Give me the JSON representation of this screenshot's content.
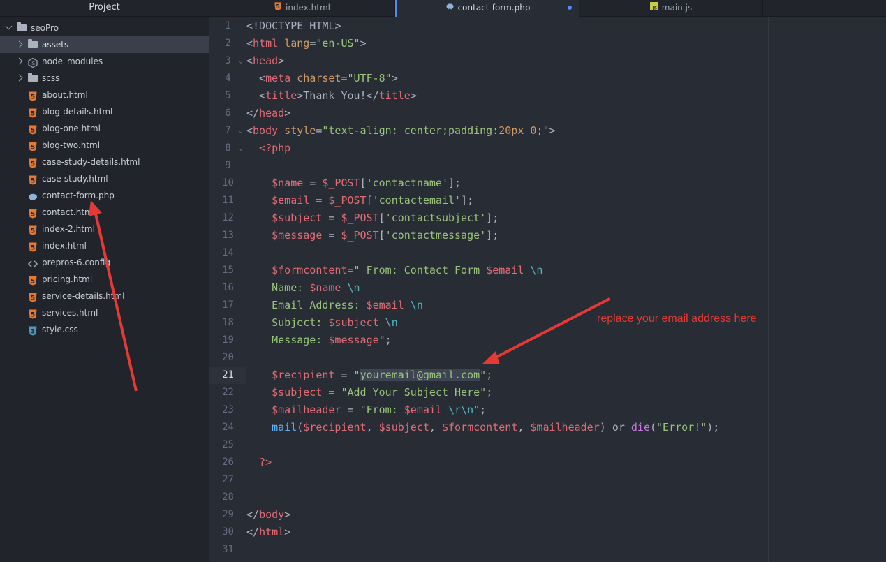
{
  "sidebar": {
    "title": "Project",
    "root": "seoPro",
    "items": [
      {
        "label": "assets",
        "kind": "folder"
      },
      {
        "label": "node_modules",
        "kind": "folder-node"
      },
      {
        "label": "scss",
        "kind": "folder"
      },
      {
        "label": "about.html",
        "kind": "html"
      },
      {
        "label": "blog-details.html",
        "kind": "html"
      },
      {
        "label": "blog-one.html",
        "kind": "html"
      },
      {
        "label": "blog-two.html",
        "kind": "html"
      },
      {
        "label": "case-study-details.html",
        "kind": "html"
      },
      {
        "label": "case-study.html",
        "kind": "html"
      },
      {
        "label": "contact-form.php",
        "kind": "php"
      },
      {
        "label": "contact.html",
        "kind": "html"
      },
      {
        "label": "index-2.html",
        "kind": "html"
      },
      {
        "label": "index.html",
        "kind": "html"
      },
      {
        "label": "prepros-6.config",
        "kind": "config"
      },
      {
        "label": "pricing.html",
        "kind": "html"
      },
      {
        "label": "service-details.html",
        "kind": "html"
      },
      {
        "label": "services.html",
        "kind": "html"
      },
      {
        "label": "style.css",
        "kind": "css"
      }
    ]
  },
  "tabs": [
    {
      "label": "index.html",
      "icon": "html5-icon"
    },
    {
      "label": "contact-form.php",
      "icon": "php-elephant-icon",
      "active": true,
      "modified": true
    },
    {
      "label": "main.js",
      "icon": "js-icon"
    }
  ],
  "editor": {
    "cursor_line": 21,
    "lines": [
      {
        "n": "1",
        "tokens": [
          {
            "t": "<!DOCTYPE HTML>",
            "c": "plain"
          }
        ]
      },
      {
        "n": "2",
        "tokens": [
          {
            "t": "<",
            "c": "plain"
          },
          {
            "t": "html",
            "c": "tag"
          },
          {
            "t": " lang",
            "c": "attr"
          },
          {
            "t": "=",
            "c": "plain"
          },
          {
            "t": "\"en-US\"",
            "c": "str"
          },
          {
            "t": ">",
            "c": "plain"
          }
        ]
      },
      {
        "n": "3",
        "tokens": [
          {
            "t": "<",
            "c": "plain"
          },
          {
            "t": "head",
            "c": "tag"
          },
          {
            "t": ">",
            "c": "plain"
          }
        ]
      },
      {
        "n": "4",
        "tokens": [
          {
            "t": "  <",
            "c": "plain"
          },
          {
            "t": "meta",
            "c": "tag"
          },
          {
            "t": " charset",
            "c": "attr"
          },
          {
            "t": "=",
            "c": "plain"
          },
          {
            "t": "\"UTF-8\"",
            "c": "str"
          },
          {
            "t": ">",
            "c": "plain"
          }
        ]
      },
      {
        "n": "5",
        "tokens": [
          {
            "t": "  <",
            "c": "plain"
          },
          {
            "t": "title",
            "c": "tag"
          },
          {
            "t": ">Thank You!</",
            "c": "plain"
          },
          {
            "t": "title",
            "c": "tag"
          },
          {
            "t": ">",
            "c": "plain"
          }
        ]
      },
      {
        "n": "6",
        "tokens": [
          {
            "t": "</",
            "c": "plain"
          },
          {
            "t": "head",
            "c": "tag"
          },
          {
            "t": ">",
            "c": "plain"
          }
        ]
      },
      {
        "n": "7",
        "tokens": [
          {
            "t": "<",
            "c": "plain"
          },
          {
            "t": "body",
            "c": "tag"
          },
          {
            "t": " style",
            "c": "attr"
          },
          {
            "t": "=",
            "c": "plain"
          },
          {
            "t": "\"text-align: center;padding:",
            "c": "str"
          },
          {
            "t": "20px 0",
            "c": "attr"
          },
          {
            "t": ";\"",
            "c": "str"
          },
          {
            "t": ">",
            "c": "plain"
          }
        ]
      },
      {
        "n": "8",
        "tokens": [
          {
            "t": "  <?php",
            "c": "tag"
          }
        ]
      },
      {
        "n": "9",
        "tokens": []
      },
      {
        "n": "10",
        "tokens": [
          {
            "t": "    $name",
            "c": "var"
          },
          {
            "t": " = ",
            "c": "plain"
          },
          {
            "t": "$_POST",
            "c": "var"
          },
          {
            "t": "[",
            "c": "plain"
          },
          {
            "t": "'contactname'",
            "c": "str"
          },
          {
            "t": "];",
            "c": "plain"
          }
        ]
      },
      {
        "n": "11",
        "tokens": [
          {
            "t": "    $email",
            "c": "var"
          },
          {
            "t": " = ",
            "c": "plain"
          },
          {
            "t": "$_POST",
            "c": "var"
          },
          {
            "t": "[",
            "c": "plain"
          },
          {
            "t": "'contactemail'",
            "c": "str"
          },
          {
            "t": "];",
            "c": "plain"
          }
        ]
      },
      {
        "n": "12",
        "tokens": [
          {
            "t": "    $subject",
            "c": "var"
          },
          {
            "t": " = ",
            "c": "plain"
          },
          {
            "t": "$_POST",
            "c": "var"
          },
          {
            "t": "[",
            "c": "plain"
          },
          {
            "t": "'contactsubject'",
            "c": "str"
          },
          {
            "t": "];",
            "c": "plain"
          }
        ]
      },
      {
        "n": "13",
        "tokens": [
          {
            "t": "    $message",
            "c": "var"
          },
          {
            "t": " = ",
            "c": "plain"
          },
          {
            "t": "$_POST",
            "c": "var"
          },
          {
            "t": "[",
            "c": "plain"
          },
          {
            "t": "'contactmessage'",
            "c": "str"
          },
          {
            "t": "];",
            "c": "plain"
          }
        ]
      },
      {
        "n": "14",
        "tokens": []
      },
      {
        "n": "15",
        "tokens": [
          {
            "t": "    $formcontent",
            "c": "var"
          },
          {
            "t": "=",
            "c": "plain"
          },
          {
            "t": "\" From: Contact Form ",
            "c": "str"
          },
          {
            "t": "$email",
            "c": "var"
          },
          {
            "t": " \\n",
            "c": "esc"
          }
        ]
      },
      {
        "n": "16",
        "tokens": [
          {
            "t": "    Name: ",
            "c": "str"
          },
          {
            "t": "$name",
            "c": "var"
          },
          {
            "t": " \\n",
            "c": "esc"
          }
        ]
      },
      {
        "n": "17",
        "tokens": [
          {
            "t": "    Email Address: ",
            "c": "str"
          },
          {
            "t": "$email",
            "c": "var"
          },
          {
            "t": " \\n",
            "c": "esc"
          }
        ]
      },
      {
        "n": "18",
        "tokens": [
          {
            "t": "    Subject: ",
            "c": "str"
          },
          {
            "t": "$subject",
            "c": "var"
          },
          {
            "t": " \\n",
            "c": "esc"
          }
        ]
      },
      {
        "n": "19",
        "tokens": [
          {
            "t": "    Message: ",
            "c": "str"
          },
          {
            "t": "$message",
            "c": "var"
          },
          {
            "t": "\";",
            "c": "plain"
          }
        ]
      },
      {
        "n": "20",
        "tokens": []
      },
      {
        "n": "21",
        "tokens": [
          {
            "t": "    $recipient",
            "c": "var"
          },
          {
            "t": " = ",
            "c": "plain"
          },
          {
            "t": "\"",
            "c": "str"
          },
          {
            "t": "youremail@gmail.com",
            "c": "str",
            "sel": true
          },
          {
            "t": "\"",
            "c": "str"
          },
          {
            "t": ";",
            "c": "plain"
          }
        ]
      },
      {
        "n": "22",
        "tokens": [
          {
            "t": "    $subject",
            "c": "var"
          },
          {
            "t": " = ",
            "c": "plain"
          },
          {
            "t": "\"Add Your Subject Here\"",
            "c": "str"
          },
          {
            "t": ";",
            "c": "plain"
          }
        ]
      },
      {
        "n": "23",
        "tokens": [
          {
            "t": "    $mailheader",
            "c": "var"
          },
          {
            "t": " = ",
            "c": "plain"
          },
          {
            "t": "\"From: ",
            "c": "str"
          },
          {
            "t": "$email",
            "c": "var"
          },
          {
            "t": " \\r\\n",
            "c": "esc"
          },
          {
            "t": "\"",
            "c": "str"
          },
          {
            "t": ";",
            "c": "plain"
          }
        ]
      },
      {
        "n": "24",
        "tokens": [
          {
            "t": "    mail",
            "c": "fn"
          },
          {
            "t": "(",
            "c": "plain"
          },
          {
            "t": "$recipient",
            "c": "var"
          },
          {
            "t": ", ",
            "c": "plain"
          },
          {
            "t": "$subject",
            "c": "var"
          },
          {
            "t": ", ",
            "c": "plain"
          },
          {
            "t": "$formcontent",
            "c": "var"
          },
          {
            "t": ", ",
            "c": "plain"
          },
          {
            "t": "$mailheader",
            "c": "var"
          },
          {
            "t": ") ",
            "c": "plain"
          },
          {
            "t": "or",
            "c": "plain"
          },
          {
            "t": " ",
            "c": "plain"
          },
          {
            "t": "die",
            "c": "kw"
          },
          {
            "t": "(",
            "c": "plain"
          },
          {
            "t": "\"Error!\"",
            "c": "str"
          },
          {
            "t": ");",
            "c": "plain"
          }
        ]
      },
      {
        "n": "25",
        "tokens": []
      },
      {
        "n": "26",
        "tokens": [
          {
            "t": "  ?>",
            "c": "tag"
          }
        ]
      },
      {
        "n": "27",
        "tokens": []
      },
      {
        "n": "28",
        "tokens": []
      },
      {
        "n": "29",
        "tokens": [
          {
            "t": "</",
            "c": "plain"
          },
          {
            "t": "body",
            "c": "tag"
          },
          {
            "t": ">",
            "c": "plain"
          }
        ]
      },
      {
        "n": "30",
        "tokens": [
          {
            "t": "</",
            "c": "plain"
          },
          {
            "t": "html",
            "c": "tag"
          },
          {
            "t": ">",
            "c": "plain"
          }
        ]
      },
      {
        "n": "31",
        "tokens": []
      }
    ]
  },
  "annotation": {
    "note": "replace your email address here",
    "color": "#e53935"
  },
  "colors": {
    "accent": "#568af2",
    "html_icon": "#e37933",
    "css_icon": "#519aba",
    "js_icon": "#cbcb41",
    "php_icon": "#a074c4"
  }
}
